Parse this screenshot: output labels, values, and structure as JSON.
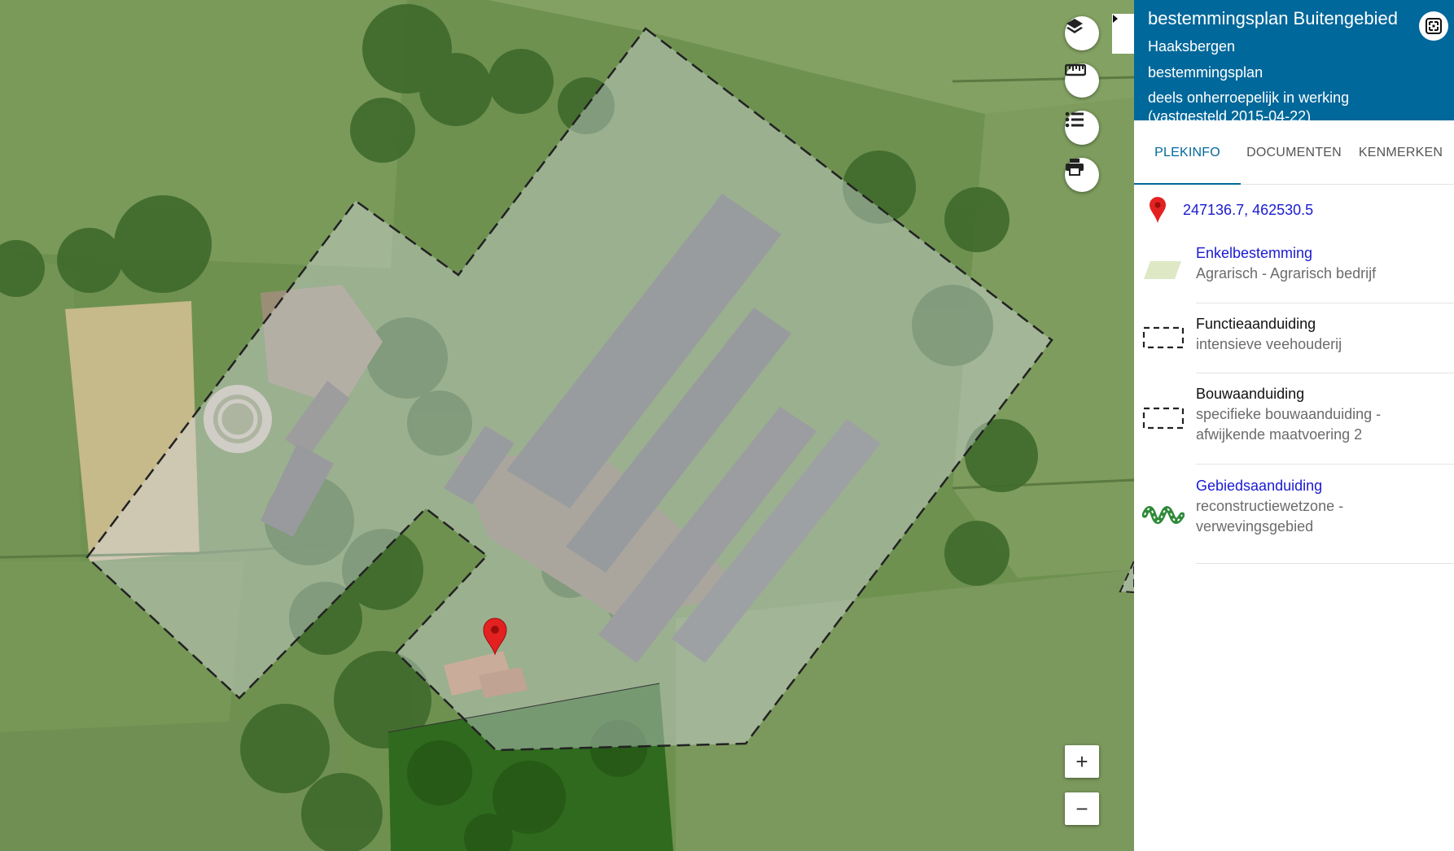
{
  "map": {
    "controls": {
      "layers_icon": "layers-icon",
      "measure_icon": "ruler-icon",
      "legend_icon": "list-icon",
      "print_icon": "printer-icon",
      "collapse_icon": "caret-right-icon",
      "zoom_in_label": "+",
      "zoom_out_label": "−"
    },
    "marker_icon": "map-pin-icon"
  },
  "panel": {
    "title": "bestemmingsplan Buitengebied",
    "municipality": "Haaksbergen",
    "plan_type": "bestemmingsplan",
    "status": "deels onherroepelijk in werking (vastgesteld 2015-04-22)",
    "fullscreen_icon": "fullscreen-icon",
    "tabs": [
      {
        "label": "PLEKINFO",
        "active": true
      },
      {
        "label": "DOCUMENTEN",
        "active": false
      },
      {
        "label": "KENMERKEN",
        "active": false
      }
    ],
    "coordinates": "247136.7, 462530.5",
    "legend": [
      {
        "title": "Enkelbestemming",
        "subtitle": "Agrarisch - Agrarisch bedrijf",
        "link": true,
        "symbol": "parallelogram-fill"
      },
      {
        "title": "Functieaanduiding",
        "subtitle": "intensieve veehouderij",
        "link": false,
        "symbol": "dashed-box"
      },
      {
        "title": "Bouwaanduiding",
        "subtitle": "specifieke bouwaanduiding - afwijkende maatvoering 2",
        "link": false,
        "symbol": "dashed-box"
      },
      {
        "title": "Gebiedsaanduiding",
        "subtitle": "reconstructiewetzone - verwevingsgebied",
        "link": true,
        "symbol": "green-wave"
      }
    ],
    "colors": {
      "header": "#01689b",
      "link": "#1a1ad1",
      "tab_active": "#01689b"
    }
  }
}
